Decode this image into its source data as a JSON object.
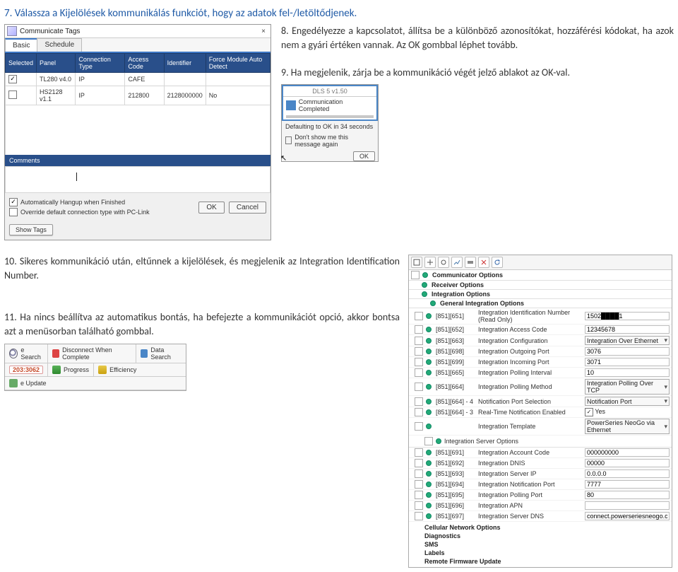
{
  "step7": "7. Válassza a Kijelölések kommunikálás funkciót, hogy az adatok fel-/letöltődjenek.",
  "step8": "8. Engedélyezze a kapcsolatot, állítsa be a különböző azonosítókat, hozzáférési kódokat, ha azok nem a gyári értéken vannak. Az OK gombbal léphet tovább.",
  "step9": "9. Ha megjelenik, zárja be a kommunikáció végét jelző ablakot az OK-val.",
  "step10": "10. Sikeres kommunikáció után, eltűnnek a kijelölések, és megjelenik az Integration Identification Number.",
  "step11": "11. Ha nincs beállítva az automatikus bontás, ha befejezte a kommunikációt opció, akkor bontsa azt a menüsorban található gombbal.",
  "fig1": {
    "title": "Communicate Tags",
    "close": "×",
    "tabs": {
      "basic": "Basic",
      "schedule": "Schedule"
    },
    "cols": {
      "selected": "Selected",
      "panel": "Panel",
      "conn": "Connection Type",
      "access": "Access Code",
      "ident": "Identifier",
      "force": "Force Module Auto Detect"
    },
    "rows": [
      {
        "sel": true,
        "panel": "TL280 v4.0",
        "conn": "IP",
        "access": "CAFE",
        "ident": "",
        "force": ""
      },
      {
        "sel": false,
        "panel": "HS2128 v1.1",
        "conn": "IP",
        "access": "212800",
        "ident": "2128000000",
        "force": "No"
      }
    ],
    "comments": "Comments",
    "autoHangup": "Automatically Hangup when Finished",
    "override": "Override default connection type with PC-Link",
    "ok": "OK",
    "cancel": "Cancel",
    "showTags": "Show Tags"
  },
  "fig2": {
    "product": "DLS 5 v1.50",
    "status": "Communication Completed",
    "default": "Defaulting to OK in 34 seconds",
    "dontshow": "Don't show me this message again",
    "ok": "OK"
  },
  "fig3": {
    "headers": {
      "commOpts": "Communicator Options",
      "recvOpts": "Receiver Options",
      "intOpts": "Integration Options",
      "genInt": "General Integration Options",
      "intServer": "Integration Server Options"
    },
    "rows": [
      {
        "code": "[851][651]",
        "desc": "Integration Identification Number (Read Only)",
        "val": "1502████1",
        "type": "text"
      },
      {
        "code": "[851][652]",
        "desc": "Integration Access Code",
        "val": "12345678",
        "type": "text"
      },
      {
        "code": "[851][663]",
        "desc": "Integration Configuration",
        "val": "Integration Over Ethernet",
        "type": "dd"
      },
      {
        "code": "[851][698]",
        "desc": "Integration Outgoing Port",
        "val": "3076",
        "type": "text"
      },
      {
        "code": "[851][699]",
        "desc": "Integration Incoming Port",
        "val": "3071",
        "type": "text"
      },
      {
        "code": "[851][665]",
        "desc": "Integration Polling Interval",
        "val": "10",
        "type": "text"
      },
      {
        "code": "[851][664]",
        "desc": "Integration Polling Method",
        "val": "Integration Polling Over TCP",
        "type": "dd"
      },
      {
        "code": "[851][664] - 4",
        "desc": "Notification Port Selection",
        "val": "Notification Port",
        "type": "dd"
      },
      {
        "code": "[851][664] - 3",
        "desc": "Real-Time Notification Enabled",
        "val": "Yes",
        "type": "chk"
      },
      {
        "code": "",
        "desc": "Integration Template",
        "val": "PowerSeries NeoGo via Ethernet",
        "type": "dd"
      }
    ],
    "serverRows": [
      {
        "code": "[851][691]",
        "desc": "Integration Account Code",
        "val": "000000000"
      },
      {
        "code": "[851][692]",
        "desc": "Integration DNIS",
        "val": "00000"
      },
      {
        "code": "[851][693]",
        "desc": "Integration Server IP",
        "val": "0.0.0.0"
      },
      {
        "code": "[851][694]",
        "desc": "Integration Notification Port",
        "val": "7777"
      },
      {
        "code": "[851][695]",
        "desc": "Integration Polling Port",
        "val": "80"
      },
      {
        "code": "[851][696]",
        "desc": "Integration APN",
        "val": ""
      },
      {
        "code": "[851][697]",
        "desc": "Integration Server DNS",
        "val": "connect.powerseriesneogo.com"
      }
    ],
    "rest": {
      "cellular": "Cellular Network Options",
      "diag": "Diagnostics",
      "sms": "SMS",
      "labels": "Labels",
      "remote": "Remote Firmware Update"
    }
  },
  "fig4": {
    "row1": {
      "esearch": "e Search",
      "disc": "Disconnect When Complete",
      "data": "Data Search"
    },
    "row2": {
      "code": "203:3062",
      "prog": "Progress",
      "eff": "Efficiency"
    },
    "row3": {
      "upd": "e Update"
    }
  }
}
